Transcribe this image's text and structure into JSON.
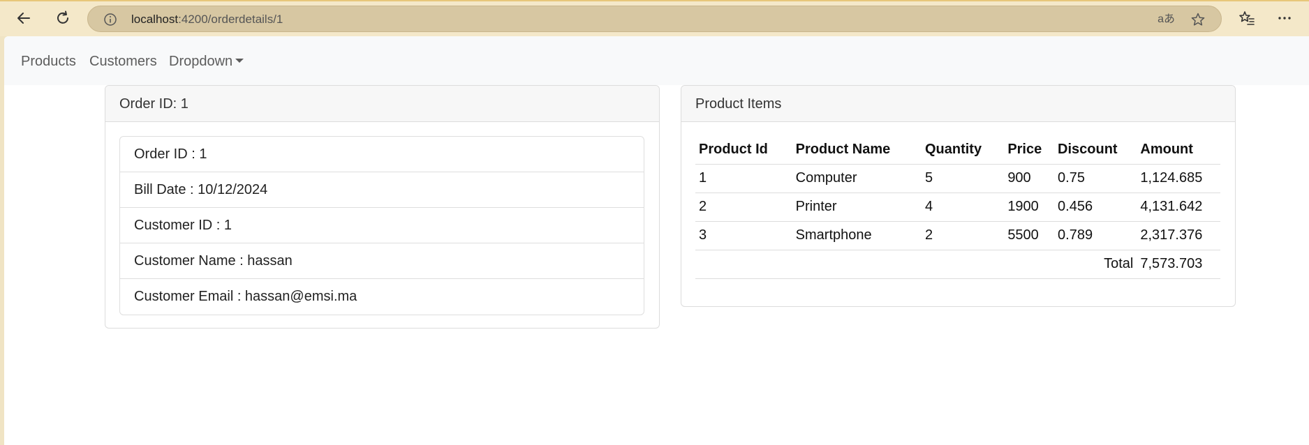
{
  "browser": {
    "url_host": "localhost",
    "url_path": ":4200/orderdetails/1",
    "read_aloud_label": "aあ"
  },
  "navbar": {
    "products": "Products",
    "customers": "Customers",
    "dropdown": "Dropdown"
  },
  "order_card": {
    "title": "Order ID: 1",
    "fields": [
      "Order ID : 1",
      "Bill Date : 10/12/2024",
      "Customer ID : 1",
      "Customer Name : hassan",
      "Customer Email : hassan@emsi.ma"
    ]
  },
  "items_card": {
    "title": "Product Items",
    "headers": [
      "Product Id",
      "Product Name",
      "Quantity",
      "Price",
      "Discount",
      "Amount"
    ],
    "rows": [
      [
        "1",
        "Computer",
        "5",
        "900",
        "0.75",
        "1,124.685"
      ],
      [
        "2",
        "Printer",
        "4",
        "1900",
        "0.456",
        "4,131.642"
      ],
      [
        "3",
        "Smartphone",
        "2",
        "5500",
        "0.789",
        "2,317.376"
      ]
    ],
    "total_label": "Total",
    "total_value": "7,573.703"
  }
}
